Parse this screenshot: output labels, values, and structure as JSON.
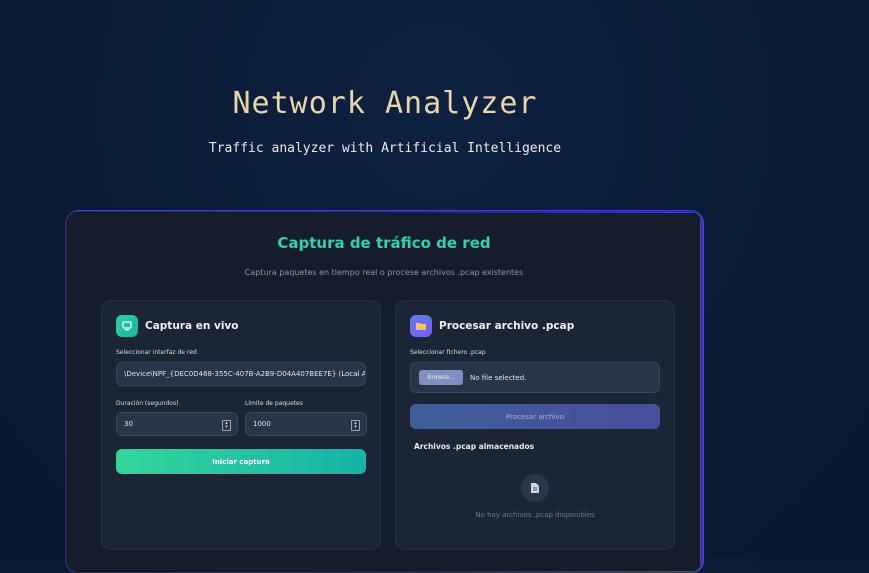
{
  "hero": {
    "title": "Network Analyzer",
    "subtitle": "Traffic analyzer with Artificial Intelligence"
  },
  "card": {
    "title": "Captura de tráfico de red",
    "description": "Captura paquetes en tiempo real o procese archivos .pcap existentes"
  },
  "live": {
    "title": "Captura en vivo",
    "interface_label": "Seleccionar interfaz de red",
    "interface_value": "\\Device\\NPF_{DEC0D468-355C-407B-A2B9-D04A407BEE7E} (Local Ar",
    "duration_label": "Duración (segundos)",
    "duration_value": "30",
    "limit_label": "Límite de paquetes",
    "limit_value": "1000",
    "start_button": "Iniciar captura"
  },
  "pcap": {
    "title": "Procesar archivo .pcap",
    "file_label": "Seleccionar fichero .pcap",
    "browse_button": "Browse...",
    "file_status": "No file selected.",
    "process_button": "Procesar archivo",
    "stored_title": "Archivos .pcap almacenados",
    "empty_text": "No hay archivos .pcap disponibles"
  },
  "icons": {
    "live": "network-card-icon",
    "pcap": "folder-icon",
    "empty": "document-icon"
  },
  "colors": {
    "accent_teal": "#2fd1b0",
    "title_gold": "#e9d6a8",
    "primary_button": "#33d69a",
    "process_button": "#3e5f97"
  }
}
